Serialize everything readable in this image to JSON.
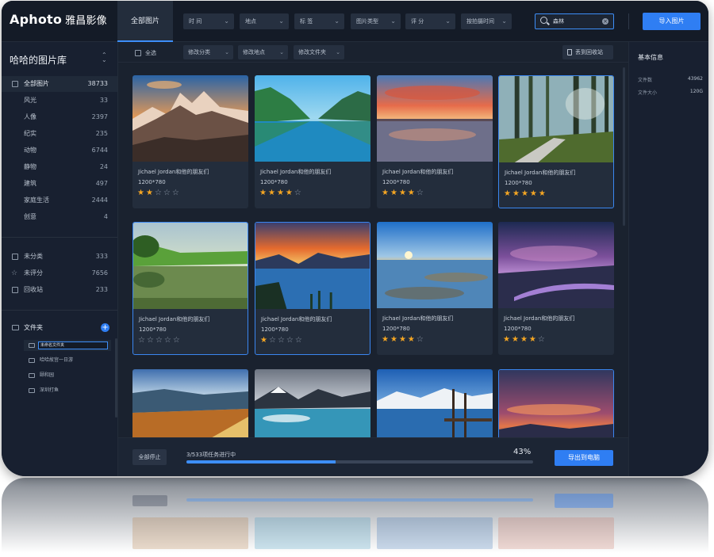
{
  "app": {
    "logo": "Aphoto",
    "logo_cn": "雅昌影像"
  },
  "topbar": {
    "tab_all": "全部图片",
    "filters": [
      {
        "label": "时 间"
      },
      {
        "label": "地点"
      },
      {
        "label": "标 签"
      },
      {
        "label": "图片类型"
      },
      {
        "label": "评 分"
      },
      {
        "label": "按拍摄时间"
      }
    ],
    "search": {
      "value": "森林"
    },
    "import_label": "导入图片"
  },
  "sidebar": {
    "library_title": "哈哈的图片库",
    "categories": [
      {
        "label": "全部图片",
        "count": "38733"
      },
      {
        "label": "风光",
        "count": "33"
      },
      {
        "label": "人像",
        "count": "2397"
      },
      {
        "label": "纪实",
        "count": "235"
      },
      {
        "label": "动物",
        "count": "6744"
      },
      {
        "label": "静物",
        "count": "24"
      },
      {
        "label": "建筑",
        "count": "497"
      },
      {
        "label": "家庭生活",
        "count": "2444"
      },
      {
        "label": "创意",
        "count": "4"
      }
    ],
    "special": [
      {
        "label": "未分类",
        "count": "333"
      },
      {
        "label": "未评分",
        "count": "7656"
      },
      {
        "label": "回收站",
        "count": "233"
      }
    ],
    "folder_title": "文件夹",
    "folders": [
      {
        "label": "未命名文件夹"
      },
      {
        "label": "哈哈故宫一日游"
      },
      {
        "label": "颐和园"
      },
      {
        "label": "深圳打鱼"
      }
    ]
  },
  "toolbar2": {
    "select_all": "全选",
    "edit_category": "修改分类",
    "edit_location": "修改地点",
    "edit_folder": "修改文件夹",
    "recycle": "丢到回收站"
  },
  "photos": [
    {
      "title": "Jichael Jordan和他的朋友们",
      "dims": "1200*780",
      "rating": 2,
      "selected": false
    },
    {
      "title": "Jichael Jordan和他的朋友们",
      "dims": "1200*780",
      "rating": 4,
      "selected": false
    },
    {
      "title": "Jichael Jordan和他的朋友们",
      "dims": "1200*780",
      "rating": 4,
      "selected": false
    },
    {
      "title": "Jichael Jordan和他的朋友们",
      "dims": "1200*780",
      "rating": 5,
      "selected": true
    },
    {
      "title": "Jichael Jordan和他的朋友们",
      "dims": "1200*780",
      "rating": 0,
      "selected": true
    },
    {
      "title": "Jichael Jordan和他的朋友们",
      "dims": "1200*780",
      "rating": 1,
      "selected": true
    },
    {
      "title": "Jichael Jordan和他的朋友们",
      "dims": "1200*780",
      "rating": 4,
      "selected": false
    },
    {
      "title": "Jichael Jordan和他的朋友们",
      "dims": "1200*780",
      "rating": 4,
      "selected": false
    },
    {
      "title": "",
      "dims": "",
      "rating": 0,
      "selected": false
    },
    {
      "title": "",
      "dims": "",
      "rating": 0,
      "selected": false
    },
    {
      "title": "",
      "dims": "",
      "rating": 0,
      "selected": false
    },
    {
      "title": "",
      "dims": "",
      "rating": 0,
      "selected": true
    }
  ],
  "info_panel": {
    "title": "基本信息",
    "rows": [
      {
        "label": "文件数",
        "value": "43962"
      },
      {
        "label": "文件大小",
        "value": "120G"
      }
    ]
  },
  "bottombar": {
    "stop_all": "全部停止",
    "task_text": "3/533项任务进行中",
    "progress_percent": 43,
    "progress_label": "43%",
    "export": "导出到电脑"
  },
  "colors": {
    "accent": "#2f7ef3",
    "star": "#f5a623",
    "panel": "#1a222f"
  }
}
